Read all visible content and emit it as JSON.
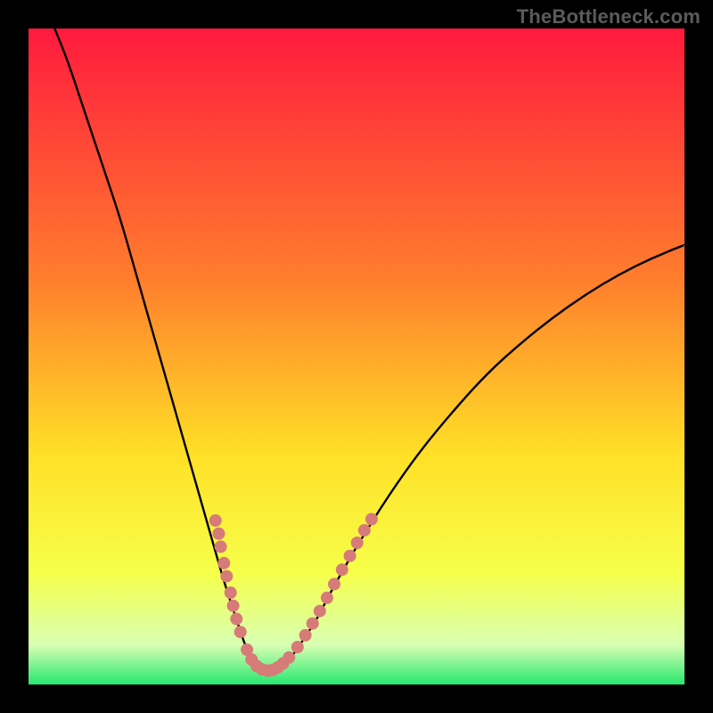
{
  "watermark": "TheBottleneck.com",
  "colors": {
    "frame": "#000000",
    "gradient_top": "#ff1a3e",
    "gradient_mid1": "#ff7d2d",
    "gradient_mid2": "#ffe027",
    "gradient_mid3": "#f6ff4a",
    "gradient_bottom_light": "#d8ffb3",
    "gradient_bottom": "#27e86f",
    "curve": "#000000",
    "dots": "#d67b78"
  },
  "chart_data": {
    "type": "line",
    "title": "",
    "xlabel": "",
    "ylabel": "",
    "xlim": [
      0,
      100
    ],
    "ylim": [
      0,
      100
    ],
    "grid": false,
    "legend": false,
    "series": [
      {
        "name": "bottleneck-curve",
        "x": [
          4,
          6,
          8,
          10,
          12,
          14,
          16,
          18,
          20,
          22,
          24,
          26,
          28,
          30,
          32,
          33,
          34,
          35,
          36,
          37,
          38,
          40,
          42,
          44,
          46,
          48,
          50,
          55,
          60,
          65,
          70,
          75,
          80,
          85,
          90,
          95,
          100
        ],
        "y": [
          100,
          95,
          89,
          83,
          77,
          71,
          64,
          57,
          50,
          43,
          36,
          29,
          22,
          15,
          9,
          6,
          4,
          2.5,
          2,
          2,
          2.5,
          4,
          7,
          10,
          14,
          17.5,
          21,
          29,
          36,
          42,
          47.5,
          52,
          56,
          59.5,
          62.5,
          65,
          67
        ]
      }
    ],
    "annotations": {
      "dot_cluster": {
        "description": "salmon dotted segments near the curve minimum",
        "points": [
          {
            "x": 28.5,
            "y": 25
          },
          {
            "x": 29.0,
            "y": 23
          },
          {
            "x": 29.3,
            "y": 21
          },
          {
            "x": 29.8,
            "y": 18.5
          },
          {
            "x": 30.2,
            "y": 16.5
          },
          {
            "x": 30.8,
            "y": 14
          },
          {
            "x": 31.2,
            "y": 12
          },
          {
            "x": 31.7,
            "y": 10
          },
          {
            "x": 32.3,
            "y": 8
          },
          {
            "x": 33.3,
            "y": 5.3
          },
          {
            "x": 34.0,
            "y": 3.8
          },
          {
            "x": 34.8,
            "y": 2.8
          },
          {
            "x": 35.6,
            "y": 2.3
          },
          {
            "x": 36.4,
            "y": 2.1
          },
          {
            "x": 37.2,
            "y": 2.2
          },
          {
            "x": 38.0,
            "y": 2.6
          },
          {
            "x": 38.8,
            "y": 3.2
          },
          {
            "x": 39.7,
            "y": 4.1
          },
          {
            "x": 41.0,
            "y": 5.7
          },
          {
            "x": 42.2,
            "y": 7.5
          },
          {
            "x": 43.3,
            "y": 9.3
          },
          {
            "x": 44.4,
            "y": 11.2
          },
          {
            "x": 45.5,
            "y": 13.2
          },
          {
            "x": 46.6,
            "y": 15.3
          },
          {
            "x": 47.8,
            "y": 17.5
          },
          {
            "x": 49.0,
            "y": 19.6
          },
          {
            "x": 50.1,
            "y": 21.6
          },
          {
            "x": 51.2,
            "y": 23.5
          },
          {
            "x": 52.3,
            "y": 25.2
          }
        ]
      }
    }
  }
}
